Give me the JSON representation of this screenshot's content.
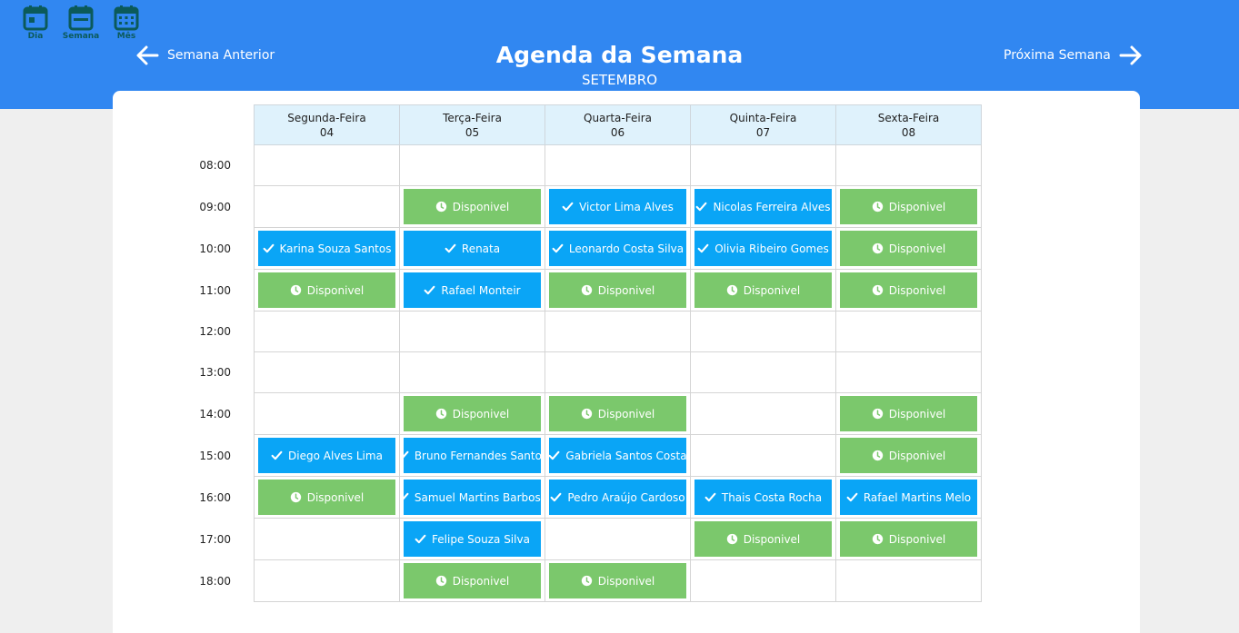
{
  "view_switch": [
    {
      "label": "Dia",
      "icon": "calendar-day-icon"
    },
    {
      "label": "Semana",
      "icon": "calendar-week-icon"
    },
    {
      "label": "Mês",
      "icon": "calendar-month-icon"
    }
  ],
  "header": {
    "title": "Agenda da Semana",
    "subtitle": "SETEMBRO",
    "prev_label": "Semana Anterior",
    "next_label": "Próxima Semana"
  },
  "colors": {
    "header": "#3187f1",
    "available": "#7bc86c",
    "booked": "#0aa5f6",
    "day_header": "#dff2fc"
  },
  "days": [
    {
      "name": "Segunda-Feira",
      "date": "04"
    },
    {
      "name": "Terça-Feira",
      "date": "05"
    },
    {
      "name": "Quarta-Feira",
      "date": "06"
    },
    {
      "name": "Quinta-Feira",
      "date": "07"
    },
    {
      "name": "Sexta-Feira",
      "date": "08"
    }
  ],
  "rows": [
    {
      "time": "08:00",
      "slots": [
        null,
        null,
        null,
        null,
        null
      ]
    },
    {
      "time": "09:00",
      "slots": [
        null,
        {
          "status": "available",
          "label": "Disponivel"
        },
        {
          "status": "booked",
          "label": "Victor Lima Alves"
        },
        {
          "status": "booked",
          "label": "Nicolas Ferreira Alves"
        },
        {
          "status": "available",
          "label": "Disponivel"
        }
      ]
    },
    {
      "time": "10:00",
      "slots": [
        {
          "status": "booked",
          "label": "Karina Souza Santos"
        },
        {
          "status": "booked",
          "label": "Renata"
        },
        {
          "status": "booked",
          "label": "Leonardo Costa Silva"
        },
        {
          "status": "booked",
          "label": "Olivia Ribeiro Gomes"
        },
        {
          "status": "available",
          "label": "Disponivel"
        }
      ]
    },
    {
      "time": "11:00",
      "slots": [
        {
          "status": "available",
          "label": "Disponivel"
        },
        {
          "status": "booked",
          "label": "Rafael Monteir"
        },
        {
          "status": "available",
          "label": "Disponivel"
        },
        {
          "status": "available",
          "label": "Disponivel"
        },
        {
          "status": "available",
          "label": "Disponivel"
        }
      ]
    },
    {
      "time": "12:00",
      "slots": [
        null,
        null,
        null,
        null,
        null
      ]
    },
    {
      "time": "13:00",
      "slots": [
        null,
        null,
        null,
        null,
        null
      ]
    },
    {
      "time": "14:00",
      "slots": [
        null,
        {
          "status": "available",
          "label": "Disponivel"
        },
        {
          "status": "available",
          "label": "Disponivel"
        },
        null,
        {
          "status": "available",
          "label": "Disponivel"
        }
      ]
    },
    {
      "time": "15:00",
      "slots": [
        {
          "status": "booked",
          "label": "Diego Alves Lima"
        },
        {
          "status": "booked",
          "label": "Bruno Fernandes Santos"
        },
        {
          "status": "booked",
          "label": "Gabriela Santos Costa"
        },
        null,
        {
          "status": "available",
          "label": "Disponivel"
        }
      ]
    },
    {
      "time": "16:00",
      "slots": [
        {
          "status": "available",
          "label": "Disponivel"
        },
        {
          "status": "booked",
          "label": "Samuel Martins Barbosa"
        },
        {
          "status": "booked",
          "label": "Pedro Araújo Cardoso"
        },
        {
          "status": "booked",
          "label": "Thais Costa Rocha"
        },
        {
          "status": "booked",
          "label": "Rafael Martins Melo"
        }
      ]
    },
    {
      "time": "17:00",
      "slots": [
        null,
        {
          "status": "booked",
          "label": "Felipe Souza Silva"
        },
        null,
        {
          "status": "available",
          "label": "Disponivel"
        },
        {
          "status": "available",
          "label": "Disponivel"
        }
      ]
    },
    {
      "time": "18:00",
      "slots": [
        null,
        {
          "status": "available",
          "label": "Disponivel"
        },
        {
          "status": "available",
          "label": "Disponivel"
        },
        null,
        null
      ]
    }
  ]
}
